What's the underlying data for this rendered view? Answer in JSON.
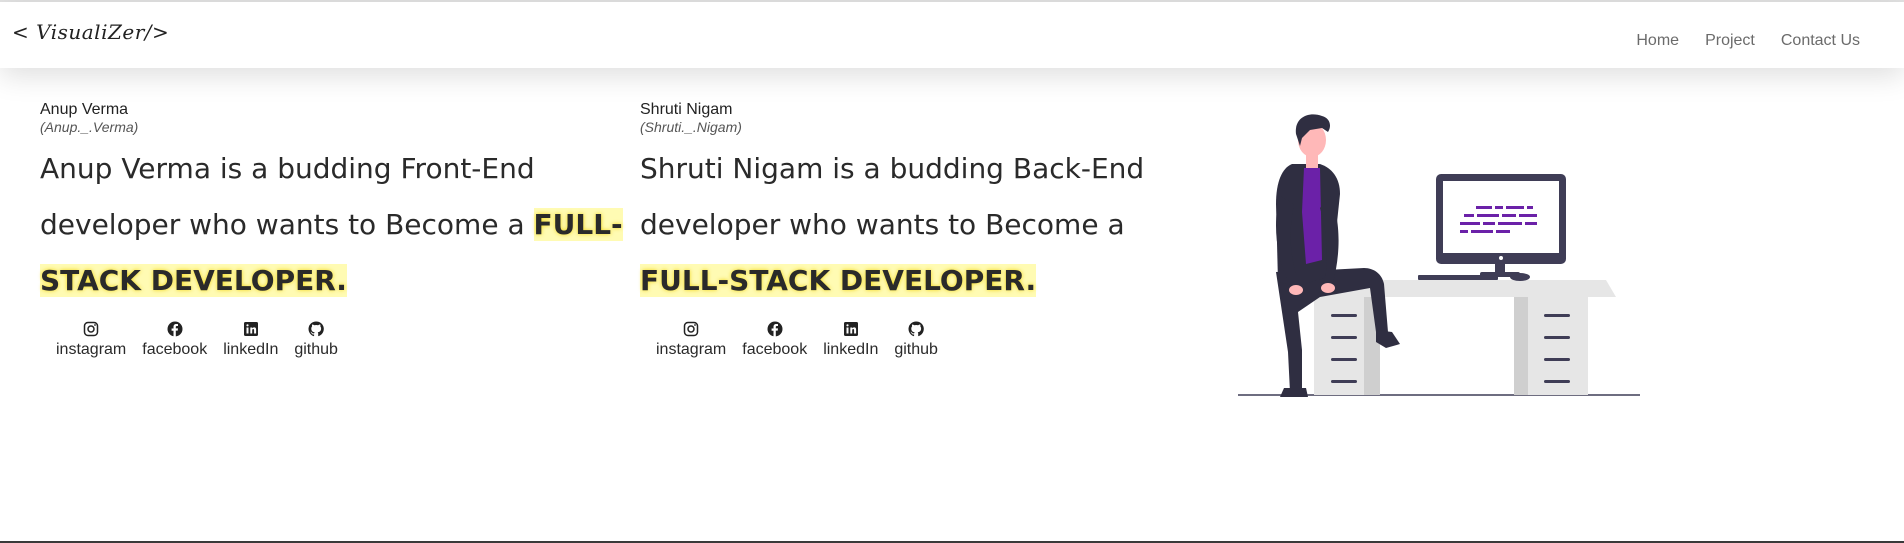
{
  "nav": {
    "logo": "< VisualiZer/>",
    "links": [
      "Home",
      "Project",
      "Contact Us"
    ]
  },
  "cards": [
    {
      "name": "Anup Verma",
      "handle": "(Anup._.Verma)",
      "bio_prefix": "Anup Verma is a budding Front-End developer who wants to Become a ",
      "bio_highlight": "FULL-STACK DEVELOPER.",
      "socials": [
        {
          "icon": "instagram-icon",
          "label": "instagram"
        },
        {
          "icon": "facebook-icon",
          "label": "facebook"
        },
        {
          "icon": "linkedin-icon",
          "label": "linkedIn"
        },
        {
          "icon": "github-icon",
          "label": "github"
        }
      ]
    },
    {
      "name": "Shruti Nigam",
      "handle": "(Shruti._.Nigam)",
      "bio_prefix": "Shruti Nigam is a budding Back-End developer who wants to Become a ",
      "bio_highlight": "FULL-STACK DEVELOPER.",
      "socials": [
        {
          "icon": "instagram-icon",
          "label": "instagram"
        },
        {
          "icon": "facebook-icon",
          "label": "facebook"
        },
        {
          "icon": "linkedin-icon",
          "label": "linkedIn"
        },
        {
          "icon": "github-icon",
          "label": "github"
        }
      ]
    }
  ],
  "colors": {
    "highlight": "#fffbb3",
    "accent_purple": "#6b21a8",
    "nav_text": "#6b6b6b"
  }
}
